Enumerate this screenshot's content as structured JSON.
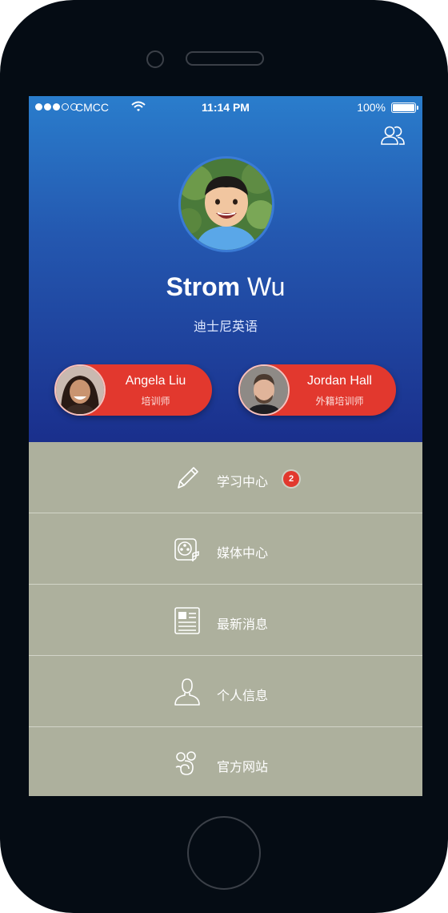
{
  "status_bar": {
    "carrier": "CMCC",
    "time": "11:14 PM",
    "battery": "100%",
    "signal_bars_filled": 3,
    "signal_bars_total": 5
  },
  "profile": {
    "first_name": "Strom",
    "last_name": "Wu",
    "subtitle": "迪士尼英语"
  },
  "teachers": [
    {
      "name": "Angela Liu",
      "role": "培训师"
    },
    {
      "name": "Jordan Hall",
      "role": "外籍培训师"
    }
  ],
  "menu": [
    {
      "label": "学习中心",
      "icon": "pencil-icon",
      "badge": "2"
    },
    {
      "label": "媒体中心",
      "icon": "film-reel-icon"
    },
    {
      "label": "最新消息",
      "icon": "newspaper-icon"
    },
    {
      "label": "个人信息",
      "icon": "person-icon"
    },
    {
      "label": "官方网站",
      "icon": "mickey-icon"
    }
  ],
  "colors": {
    "header_top": "#2a7dcc",
    "header_bottom": "#1a2f8c",
    "accent_red": "#e2382e",
    "menu_bg": "#adb09d"
  }
}
